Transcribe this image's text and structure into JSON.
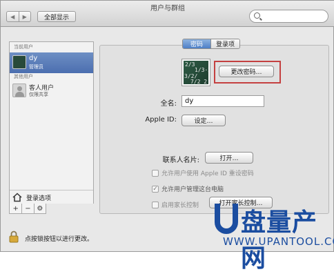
{
  "window": {
    "title": "用户与群组"
  },
  "toolbar": {
    "show_all_label": "全部显示",
    "search_placeholder": ""
  },
  "sidebar": {
    "current_users_header": "当前用户",
    "current_user": {
      "name": "dy",
      "role": "管理员"
    },
    "other_users_header": "其他用户",
    "guest_user": {
      "name": "客人用户",
      "desc": "仅限共享"
    },
    "login_options_label": "登录选项",
    "add_label": "+",
    "remove_label": "−",
    "action_icon": "gear-icon"
  },
  "tabs": [
    {
      "label": "密码",
      "active": true
    },
    {
      "label": "登录项",
      "active": false
    }
  ],
  "photo": {
    "chalk": [
      "2/3",
      "1/3·2",
      "3/2/",
      "7/2 2"
    ]
  },
  "main": {
    "change_password_label": "更改密码…",
    "full_name_label": "全名:",
    "full_name_value": "dy",
    "apple_id_label": "Apple ID:",
    "settings_label": "设定…",
    "contact_card_label": "联系人名片:",
    "open_label": "打开…",
    "allow_reset_label": "允许用户使用 Apple ID 重设密码",
    "allow_admin_label": "允许用户管理这台电脑",
    "allow_admin_checked": true,
    "enable_parental_label": "启用家长控制",
    "open_parental_label": "打开家长控制…"
  },
  "lock": {
    "text": "点按锁按钮以进行更改。"
  },
  "watermark": {
    "brand": "盘量产网",
    "url": "WWW.UPANTOOL.COM"
  },
  "colors": {
    "selection": "#4b6eaf",
    "highlight_box": "#c44040",
    "watermark": "#1b4da0"
  }
}
